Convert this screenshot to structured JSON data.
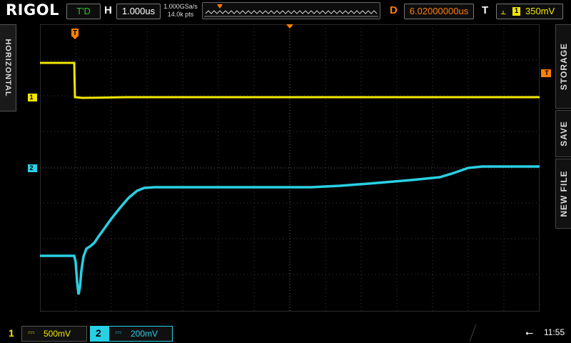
{
  "header": {
    "brand": "RIGOL",
    "run_state": "T'D",
    "horizontal_letter": "H",
    "timebase": "1.000us",
    "sample_rate": "1.000GSa/s",
    "memory_depth": "14.0k pts",
    "delay_letter": "D",
    "delay": "6.02000000us",
    "trigger_letter": "T",
    "trigger_source": "1",
    "trigger_level": "350mV"
  },
  "menu": {
    "left_tab": "HORIZONTAL",
    "softkeys": [
      "STORAGE",
      "SAVE",
      "NEW FILE"
    ]
  },
  "markers": {
    "trigger_position": "T",
    "ch1_ground": "1",
    "ch2_ground": "2",
    "trigger_level_marker": "T"
  },
  "channels": [
    {
      "number": "1",
      "coupling": "DC",
      "scale": "500mV",
      "color": "#f2e600"
    },
    {
      "number": "2",
      "coupling": "DC",
      "scale": "200mV",
      "color": "#29d0e3"
    }
  ],
  "status": {
    "usb_icon": "usb-icon",
    "time": "11:55"
  },
  "colors": {
    "ch1": "#f2e600",
    "ch2": "#29d0e3",
    "trigger": "#ff7f00",
    "run_state": "#29c529"
  }
}
